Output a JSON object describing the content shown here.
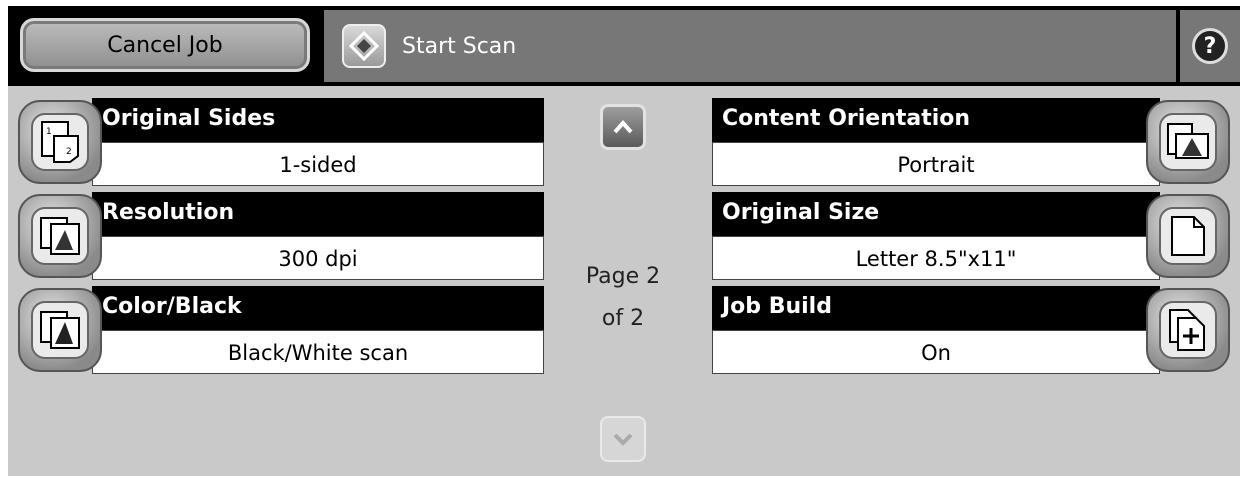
{
  "toolbar": {
    "cancel_label": "Cancel Job",
    "start_label": "Start Scan",
    "start_icon": "diamond-start-icon",
    "help_icon": "help-icon",
    "help_glyph": "?"
  },
  "options_left": [
    {
      "title": "Original Sides",
      "value": "1-sided",
      "icon": "sides-icon"
    },
    {
      "title": "Resolution",
      "value": "300 dpi",
      "icon": "resolution-icon"
    },
    {
      "title": "Color/Black",
      "value": "Black/White scan",
      "icon": "color-icon"
    }
  ],
  "options_right": [
    {
      "title": "Content Orientation",
      "value": "Portrait",
      "icon": "orientation-icon"
    },
    {
      "title": "Original Size",
      "value": "Letter 8.5\"x11\"",
      "icon": "page-icon"
    },
    {
      "title": "Job Build",
      "value": "On",
      "icon": "job-build-icon"
    }
  ],
  "pagination": {
    "page_line1": "Page 2",
    "page_line2": "of 2"
  },
  "colors": {
    "header_bg": "#000000",
    "panel_bg": "#c9c9c9",
    "start_bg": "#777777"
  }
}
